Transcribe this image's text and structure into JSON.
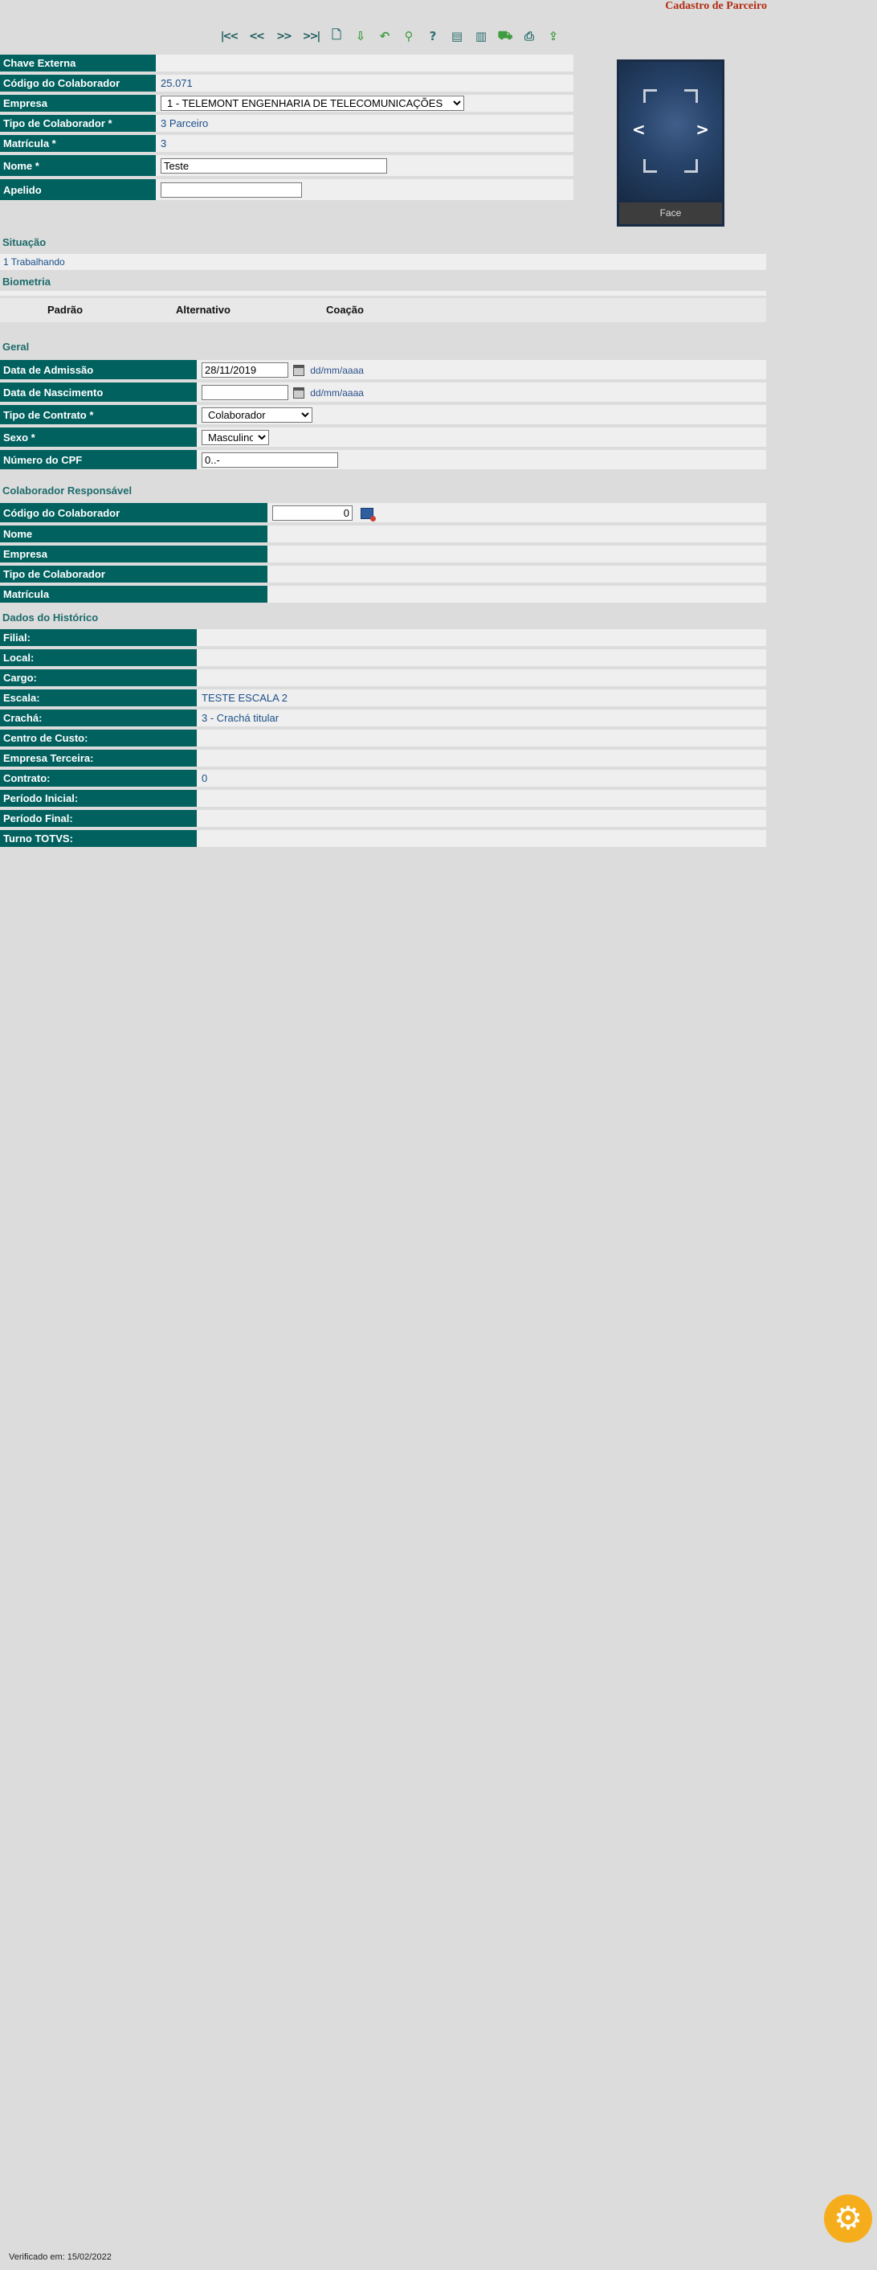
{
  "page": {
    "title": "Cadastro de Parceiro"
  },
  "toolbar": {
    "first": "|<<",
    "prev": "<<",
    "next": ">>",
    "last": ">>|",
    "icons": [
      "new-icon",
      "save-icon",
      "undo-icon",
      "search-icon",
      "help-icon",
      "report-icon",
      "document-icon",
      "vehicle-icon",
      "print-icon",
      "export-icon"
    ]
  },
  "main_form": {
    "chave_externa": {
      "label": "Chave Externa",
      "value": ""
    },
    "codigo": {
      "label": "Código do Colaborador",
      "value": "25.071"
    },
    "empresa": {
      "label": "Empresa",
      "value": "1 - TELEMONT ENGENHARIA DE TELECOMUNICAÇÕES"
    },
    "tipo": {
      "label": "Tipo de Colaborador *",
      "value": "3 Parceiro"
    },
    "matricula": {
      "label": "Matrícula *",
      "value": "3"
    },
    "nome": {
      "label": "Nome *",
      "value": "Teste"
    },
    "apelido": {
      "label": "Apelido",
      "value": ""
    }
  },
  "photo": {
    "caption": "Face",
    "prev": "<",
    "next": ">"
  },
  "situacao": {
    "title": "Situação",
    "value": "1 Trabalhando"
  },
  "biometria": {
    "title": "Biometria",
    "tabs": [
      "Padrão",
      "Alternativo",
      "Coação"
    ]
  },
  "geral": {
    "title": "Geral",
    "admissao": {
      "label": "Data de Admissão",
      "value": "28/11/2019",
      "hint": "dd/mm/aaaa"
    },
    "nascimento": {
      "label": "Data de Nascimento",
      "value": "",
      "hint": "dd/mm/aaaa"
    },
    "contrato": {
      "label": "Tipo de Contrato *",
      "value": "Colaborador"
    },
    "sexo": {
      "label": "Sexo *",
      "value": "Masculino"
    },
    "cpf": {
      "label": "Número do CPF",
      "value": "0..-"
    }
  },
  "responsavel": {
    "title": "Colaborador Responsável",
    "codigo": {
      "label": "Código do Colaborador",
      "value": "0"
    },
    "nome": {
      "label": "Nome",
      "value": ""
    },
    "empresa": {
      "label": "Empresa",
      "value": ""
    },
    "tipo": {
      "label": "Tipo de Colaborador",
      "value": ""
    },
    "matricula": {
      "label": "Matrícula",
      "value": ""
    }
  },
  "historico": {
    "title": "Dados do Histórico",
    "rows": [
      {
        "label": "Filial:",
        "value": ""
      },
      {
        "label": "Local:",
        "value": ""
      },
      {
        "label": "Cargo:",
        "value": ""
      },
      {
        "label": "Escala:",
        "value": "TESTE ESCALA 2"
      },
      {
        "label": "Crachá:",
        "value": "3  - Crachá titular"
      },
      {
        "label": "Centro de Custo:",
        "value": ""
      },
      {
        "label": "Empresa Terceira:",
        "value": ""
      },
      {
        "label": "Contrato:",
        "value": "0"
      },
      {
        "label": "Período Inicial:",
        "value": ""
      },
      {
        "label": "Período Final:",
        "value": ""
      },
      {
        "label": "Turno TOTVS:",
        "value": ""
      }
    ]
  },
  "footer": {
    "text": "Verificado em: 15/02/2022"
  },
  "colors": {
    "label_bg": "#00615f",
    "accent": "#b22d13",
    "gear": "#f5ad1c"
  }
}
